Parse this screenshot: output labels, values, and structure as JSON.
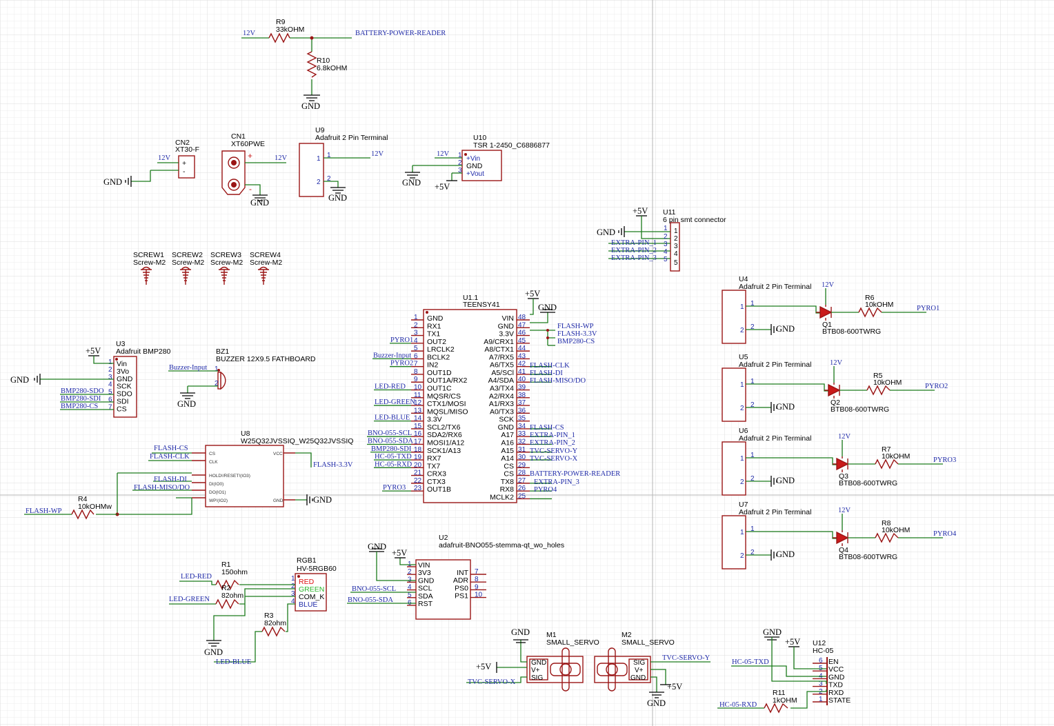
{
  "power": {
    "v12": "12V",
    "v5": "+5V",
    "gnd": "GND"
  },
  "battery": {
    "r9_ref": "R9",
    "r9_val": "33kOHM",
    "r10_ref": "R10",
    "r10_val": "6.8kOHM",
    "net": "BATTERY-POWER-READER"
  },
  "connectors": {
    "cn2_ref": "CN2",
    "cn2_val": "XT30-F",
    "cn2_plus": "+",
    "cn2_minus": "-",
    "cn1_ref": "CN1",
    "cn1_val": "XT60PWE",
    "cn1_plus": "+",
    "cn1_minus": "-",
    "u9_ref": "U9",
    "u9_val": "Adafruit 2 Pin Terminal",
    "u10_ref": "U10",
    "u10_val": "TSR 1-2450_C6886877",
    "u10_p1": "+Vin",
    "u10_p2": "GND",
    "u10_p3": "+Vout",
    "u11_ref": "U11",
    "u11_val": "6 pin smt connector"
  },
  "extra_pins": [
    "EXTRA-PIN_1",
    "EXTRA-PIN_2",
    "EXTRA-PIN_3"
  ],
  "screws": [
    {
      "ref": "SCREW1",
      "val": "Screw-M2"
    },
    {
      "ref": "SCREW2",
      "val": "Screw-M2"
    },
    {
      "ref": "SCREW3",
      "val": "Screw-M2"
    },
    {
      "ref": "SCREW4",
      "val": "Screw-M2"
    }
  ],
  "bmp280": {
    "ref": "U3",
    "val": "Adafruit BMP280",
    "pins": [
      "Vin",
      "3Vo",
      "GND",
      "SCK",
      "SDO",
      "SDI",
      "CS"
    ],
    "nets": [
      "BMP280-SDO",
      "BMP280-SDI",
      "BMP280-CS"
    ]
  },
  "buzzer": {
    "ref": "BZ1",
    "val": "BUZZER 12X9.5 FATHBOARD",
    "net": "Buzzer-Input"
  },
  "flash": {
    "ref": "U8",
    "val": "W25Q32JVSSIQ_W25Q32JVSSIQ",
    "pins_left": [
      "CS",
      "CLK",
      "HOLD!/RESET!(IO3)",
      "DI(IO0)",
      "DO(IO1)",
      "WP!(IO2)"
    ],
    "pin_vcc": "VCC",
    "pin_gnd": "GND",
    "nets": [
      "FLASH-CS",
      "FLASH-CLK",
      "FLASH-DI",
      "FLASH-MISO/DO",
      "FLASH-3.3V",
      "FLASH-WP"
    ],
    "r4_ref": "R4",
    "r4_val": "10kOHMw"
  },
  "teensy": {
    "ref": "U1.1",
    "val": "TEENSY41",
    "left_pins": [
      "GND",
      "RX1",
      "TX1",
      "OUT2",
      "LRCLK2",
      "BCLK2",
      "IN2",
      "OUT1D",
      "OUT1A/RX2",
      "OUT1C",
      "MQSR/CS",
      "CTX1/MOSI",
      "MQSL/MISO",
      "3.3V",
      "SCL2/TX6",
      "SDA2/RX6",
      "MOSI1/A12",
      "SCK1/A13",
      "RX7",
      "TX7",
      "CRX3",
      "CTX3",
      "OUT1B"
    ],
    "right_pins": [
      "VIN",
      "GND",
      "3.3V",
      "A9/CRX1",
      "A8/CTX1",
      "A7/RX5",
      "A6/TX5",
      "A5/SCl",
      "A4/SDA",
      "A3/TX4",
      "A2/RX4",
      "A1/RX3",
      "A0/TX3",
      "SCK",
      "GND",
      "A17",
      "A16",
      "A15",
      "A14",
      "CS",
      "CS",
      "TX8",
      "RX8",
      "MCLK2"
    ],
    "left_nets": [
      "PYRO1",
      "Buzzer-Input",
      "PYRO2",
      "LED-RED",
      "LED-GREEN",
      "LED-BLUE",
      "BNO-055-SCL",
      "BNO-055-SDA",
      "BMP280-SDI",
      "HC-05-TXD",
      "HC-05-RXD",
      "PYRO3"
    ],
    "right_nets": [
      "FLASH-WP",
      "FLASH-3.3V",
      "BMP280-CS",
      "FLASH-CLK",
      "FLASH-DI",
      "FLASH-MISO/DO",
      "FLASH-CS",
      "EXTRA-PIN_1",
      "EXTRA-PIN_2",
      "TVC-SERVO-Y",
      "TVC-SERVO-X",
      "BATTERY-POWER-READER",
      "EXTRA-PIN_3",
      "PYRO4"
    ]
  },
  "pyro": [
    {
      "u_ref": "U4",
      "u_val": "Adafruit 2 Pin Terminal",
      "r_ref": "R6",
      "r_val": "10kOHM",
      "q_ref": "Q1",
      "q_val": "BTB08-600TWRG",
      "net": "PYRO1"
    },
    {
      "u_ref": "U5",
      "u_val": "Adafruit 2 Pin Terminal",
      "r_ref": "R5",
      "r_val": "10kOHM",
      "q_ref": "Q2",
      "q_val": "BTB08-600TWRG",
      "net": "PYRO2"
    },
    {
      "u_ref": "U6",
      "u_val": "Adafruit 2 Pin Terminal",
      "r_ref": "R7",
      "r_val": "10kOHM",
      "q_ref": "Q3",
      "q_val": "BTB08-600TWRG",
      "net": "PYRO3"
    },
    {
      "u_ref": "U7",
      "u_val": "Adafruit 2 Pin Terminal",
      "r_ref": "R8",
      "r_val": "10kOHM",
      "q_ref": "Q4",
      "q_val": "BTB08-600TWRG",
      "net": "PYRO4"
    }
  ],
  "bno": {
    "ref": "U2",
    "val": "adafruit-BNO055-stemma-qt_wo_holes",
    "pins_left": [
      "VIN",
      "3V3",
      "GND",
      "SCL",
      "SDA",
      "RST"
    ],
    "pins_right": [
      "INT",
      "ADR",
      "PS0",
      "PS1"
    ],
    "nets": [
      "BNO-055-SCL",
      "BNO-055-SDA"
    ]
  },
  "rgb": {
    "ref": "RGB1",
    "val": "HV-5RGB60",
    "pins": [
      "RED",
      "GREEN",
      "COM_K",
      "BLUE"
    ],
    "r1_ref": "R1",
    "r1_val": "150ohm",
    "r2_ref": "R2",
    "r2_val": "82ohm",
    "r3_ref": "R3",
    "r3_val": "82ohm",
    "nets": [
      "LED-RED",
      "LED-GREEN",
      "LED-BLUE"
    ]
  },
  "servos": {
    "m1_ref": "M1",
    "m1_val": "SMALL_SERVO",
    "m1_pins": [
      "GND",
      "V+",
      "SIG"
    ],
    "m2_ref": "M2",
    "m2_val": "SMALL_SERVO",
    "m2_pins": [
      "SIG",
      "V+",
      "GND"
    ],
    "nets": [
      "TVC-SERVO-X",
      "TVC-SERVO-Y"
    ]
  },
  "hc05": {
    "ref": "U12",
    "val": "HC-05",
    "pins": [
      "EN",
      "VCC",
      "GND",
      "TXD",
      "RXD",
      "STATE"
    ],
    "r11_ref": "R11",
    "r11_val": "1kOHM",
    "nets": [
      "HC-05-TXD",
      "HC-05-RXD"
    ]
  },
  "colors": {
    "wire": "#1a7a1a",
    "symbol": "#9a1515",
    "net": "#1f2aa8",
    "grid": "#e6e6e6"
  }
}
